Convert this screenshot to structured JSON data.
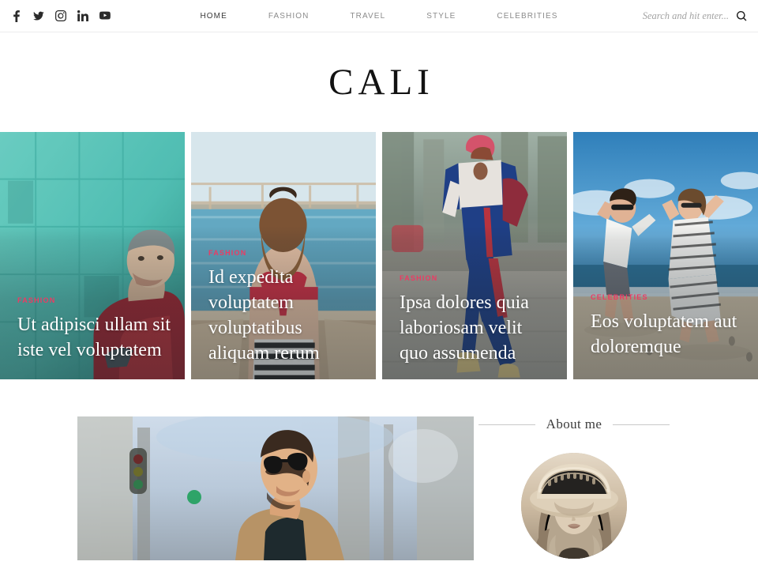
{
  "header": {
    "social": [
      {
        "name": "facebook-icon",
        "label": "Facebook"
      },
      {
        "name": "twitter-icon",
        "label": "Twitter"
      },
      {
        "name": "instagram-icon",
        "label": "Instagram"
      },
      {
        "name": "linkedin-icon",
        "label": "LinkedIn"
      },
      {
        "name": "youtube-icon",
        "label": "YouTube"
      }
    ],
    "nav": [
      {
        "label": "HOME",
        "active": true
      },
      {
        "label": "FASHION",
        "active": false
      },
      {
        "label": "TRAVEL",
        "active": false
      },
      {
        "label": "STYLE",
        "active": false
      },
      {
        "label": "CELEBRITIES",
        "active": false
      }
    ],
    "search": {
      "placeholder": "Search and hit enter...",
      "value": "",
      "icon": "search-icon"
    }
  },
  "site": {
    "logo": "CALI"
  },
  "featured": [
    {
      "category": "FASHION",
      "title": "Ut adipisci ullam sit iste vel voluptatem",
      "category_color": "#ec3b63"
    },
    {
      "category": "FASHION",
      "title": "Id expedita voluptatem voluptatibus aliquam rerum",
      "category_color": "#ec3b63"
    },
    {
      "category": "FASHION",
      "title": "Ipsa dolores quia laboriosam velit quo assumenda",
      "category_color": "#ec3b63"
    },
    {
      "category": "CELEBRITIES",
      "title": "Eos voluptatem aut doloremque",
      "category_color": "#ec3b63"
    }
  ],
  "about": {
    "title": "About me",
    "avatar_alt": "woman-in-wide-brim-hat"
  },
  "post": {
    "image_alt": "man-with-sunglasses-in-street"
  },
  "colors": {
    "accent": "#ec3b63",
    "text_dark": "#2b2b2b",
    "nav_text": "#8b8b8b",
    "border": "#ececed"
  }
}
